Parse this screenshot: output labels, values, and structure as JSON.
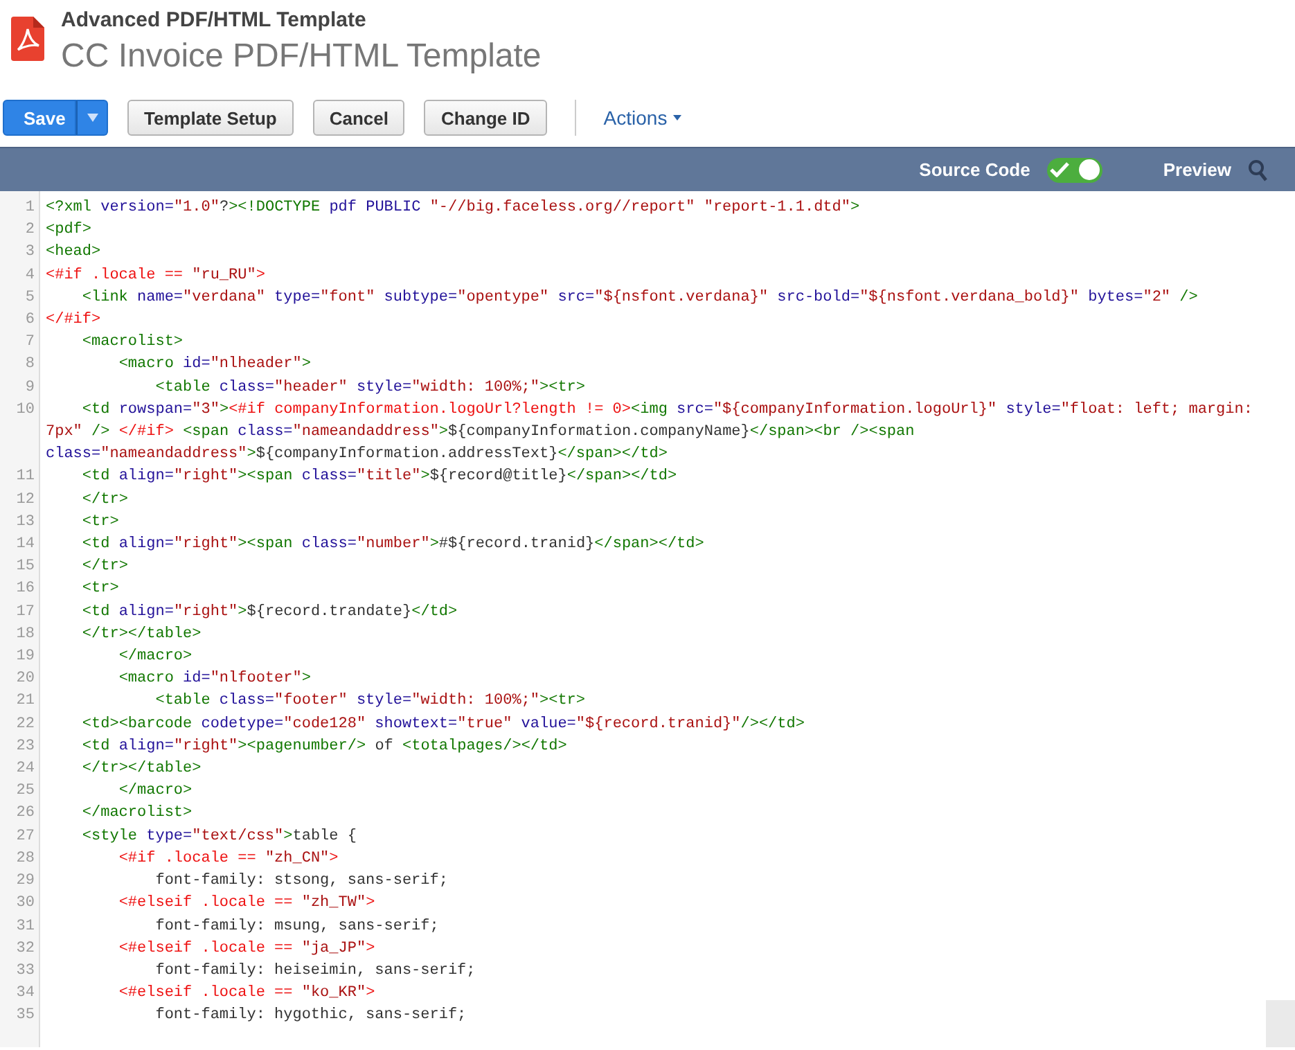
{
  "header": {
    "record_type": "Advanced PDF/HTML Template",
    "title": "CC Invoice PDF/HTML Template"
  },
  "toolbar": {
    "buttons": [
      {
        "label": "Save",
        "kind": "primary"
      },
      {
        "label": "Template Setup",
        "kind": "plain"
      },
      {
        "label": "Cancel",
        "kind": "plain"
      },
      {
        "label": "Change ID",
        "kind": "plain"
      }
    ],
    "menu": {
      "label": "Actions"
    }
  },
  "mode_bar": {
    "source_code": {
      "label": "Source Code",
      "on": true
    },
    "preview": {
      "label": "Preview"
    }
  },
  "code_lines": [
    {
      "number": "1",
      "text": "<?xml version=\"1.0\"?><!DOCTYPE pdf PUBLIC \"-//big.faceless.org//report\" \"report-1.1.dtd\">"
    },
    {
      "number": "2",
      "text": "<pdf>"
    },
    {
      "number": "3",
      "text": "<head>"
    },
    {
      "number": "4",
      "text": "<#if .locale == \"ru_RU\">"
    },
    {
      "number": "5",
      "text": "    <link name=\"verdana\" type=\"font\" subtype=\"opentype\" src=\"${nsfont.verdana}\" src-bold=\"${nsfont.verdana_bold}\" bytes=\"2\" />"
    },
    {
      "number": "6",
      "text": "</#if>"
    },
    {
      "number": "7",
      "text": "    <macrolist>"
    },
    {
      "number": "8",
      "text": "        <macro id=\"nlheader\">"
    },
    {
      "number": "9",
      "text": "            <table class=\"header\" style=\"width: 100%;\"><tr>"
    },
    {
      "number": "10",
      "text": "    <td rowspan=\"3\"><#if companyInformation.logoUrl?length != 0><img src=\"${companyInformation.logoUrl}\" style=\"float: left; margin: 7px\" /> </#if> <span class=\"nameandaddress\">${companyInformation.companyName}</span><br /><span class=\"nameandaddress\">${companyInformation.addressText}</span></td>"
    },
    {
      "number": "11",
      "text": "    <td align=\"right\"><span class=\"title\">${record@title}</span></td>"
    },
    {
      "number": "12",
      "text": "    </tr>"
    },
    {
      "number": "13",
      "text": "    <tr>"
    },
    {
      "number": "14",
      "text": "    <td align=\"right\"><span class=\"number\">#${record.tranid}</span></td>"
    },
    {
      "number": "15",
      "text": "    </tr>"
    },
    {
      "number": "16",
      "text": "    <tr>"
    },
    {
      "number": "17",
      "text": "    <td align=\"right\">${record.trandate}</td>"
    },
    {
      "number": "18",
      "text": "    </tr></table>"
    },
    {
      "number": "19",
      "text": "        </macro>"
    },
    {
      "number": "20",
      "text": "        <macro id=\"nlfooter\">"
    },
    {
      "number": "21",
      "text": "            <table class=\"footer\" style=\"width: 100%;\"><tr>"
    },
    {
      "number": "22",
      "text": "    <td><barcode codetype=\"code128\" showtext=\"true\" value=\"${record.tranid}\"/></td>"
    },
    {
      "number": "23",
      "text": "    <td align=\"right\"><pagenumber/> of <totalpages/></td>"
    },
    {
      "number": "24",
      "text": "    </tr></table>"
    },
    {
      "number": "25",
      "text": "        </macro>"
    },
    {
      "number": "26",
      "text": "    </macrolist>"
    },
    {
      "number": "27",
      "text": "    <style type=\"text/css\">table {"
    },
    {
      "number": "28",
      "text": "        <#if .locale == \"zh_CN\">"
    },
    {
      "number": "29",
      "text": "            font-family: stsong, sans-serif;"
    },
    {
      "number": "30",
      "text": "        <#elseif .locale == \"zh_TW\">"
    },
    {
      "number": "31",
      "text": "            font-family: msung, sans-serif;"
    },
    {
      "number": "32",
      "text": "        <#elseif .locale == \"ja_JP\">"
    },
    {
      "number": "33",
      "text": "            font-family: heiseimin, sans-serif;"
    },
    {
      "number": "34",
      "text": "        <#elseif .locale == \"ko_KR\">"
    },
    {
      "number": "35",
      "text": "            font-family: hygothic, sans-serif;"
    }
  ]
}
